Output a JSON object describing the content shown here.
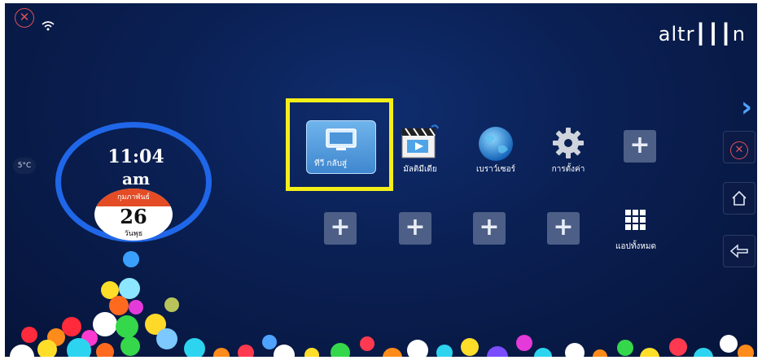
{
  "status_bar": {
    "close_icon": "close-circle-icon",
    "wifi_icon": "wifi-icon",
    "brand": "altr┃┃┃n"
  },
  "weather": {
    "temperature": "5°C"
  },
  "clock": {
    "time": "11:04",
    "ampm": "am"
  },
  "calendar": {
    "month": "กุมภาพันธ์",
    "day": "26",
    "weekday": "วันพุธ"
  },
  "apps": [
    {
      "id": "tv",
      "label": "ทีวี   กลับสู่",
      "icon": "tv-icon"
    },
    {
      "id": "multimedia",
      "label": "มัลติมีเดีย",
      "icon": "clapperboard-icon"
    },
    {
      "id": "browser",
      "label": "เบราว์เซอร์",
      "icon": "globe-icon"
    },
    {
      "id": "settings",
      "label": "การตั้งค่า",
      "icon": "gear-icon"
    }
  ],
  "all_apps": {
    "label": "แอปทั้งหมด",
    "icon": "grid-icon"
  },
  "side_controls": {
    "next": "chevron-right-icon",
    "close": "close-circle-icon",
    "home": "home-icon",
    "back": "back-arrow-icon"
  },
  "colors": {
    "background": "#0a1f52",
    "ring": "#1f67e8",
    "highlight": "#f5ef19",
    "calendar_header": "#e34c25",
    "add_tile": "#4d5f86"
  }
}
